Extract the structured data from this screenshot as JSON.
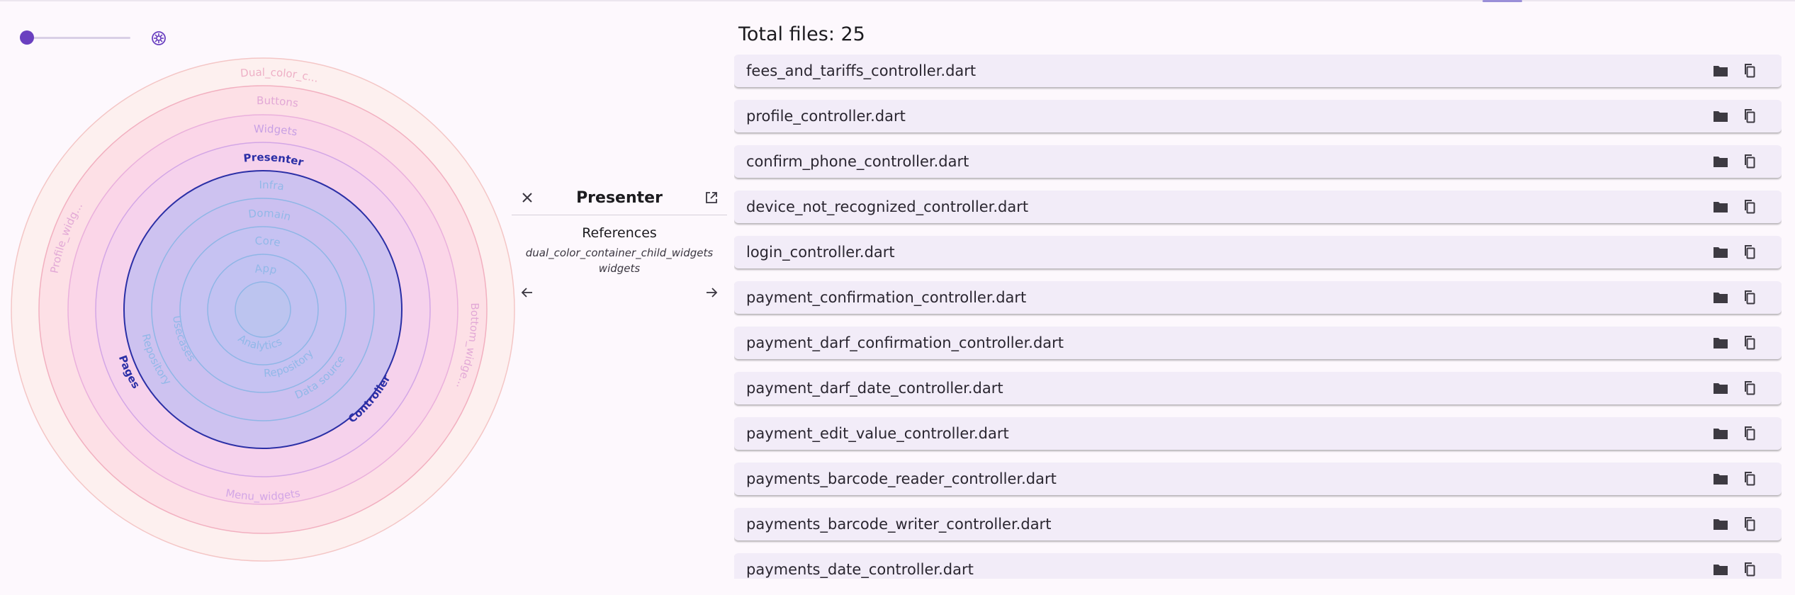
{
  "colors": {
    "accent": "#6a40c0",
    "row_background": "#f2ecf8",
    "page_background": "#fdf8fd",
    "selected_ring": "#2b2fa6"
  },
  "slider": {
    "value_fraction": 0.0
  },
  "rings": [
    {
      "label": "App",
      "selected": false
    },
    {
      "label": "Core",
      "selected": false
    },
    {
      "label": "Domain",
      "selected": false
    },
    {
      "label": "Infra",
      "selected": false
    },
    {
      "label": "Presenter",
      "selected": true
    },
    {
      "label": "Widgets",
      "selected": false
    },
    {
      "label": "Buttons",
      "selected": false
    },
    {
      "label": "Dual_color_c...",
      "selected": false
    }
  ],
  "ring_side_labels": [
    "Analytics",
    "Usecases",
    "Repository",
    "Data source",
    "Repository",
    "Pages",
    "Controller",
    "Profile_widg...",
    "Bottom_widge...",
    "Menu_widgets"
  ],
  "detail": {
    "title": "Presenter",
    "references_title": "References",
    "references": [
      "dual_color_container_child_widgets",
      "widgets"
    ]
  },
  "total_label": "Total files: 25",
  "files": [
    "fees_and_tariffs_controller.dart",
    "profile_controller.dart",
    "confirm_phone_controller.dart",
    "device_not_recognized_controller.dart",
    "login_controller.dart",
    "payment_confirmation_controller.dart",
    "payment_darf_confirmation_controller.dart",
    "payment_darf_date_controller.dart",
    "payment_edit_value_controller.dart",
    "payments_barcode_reader_controller.dart",
    "payments_barcode_writer_controller.dart",
    "payments_date_controller.dart"
  ],
  "icons": {
    "settings": "settings-wheel-icon",
    "close": "close-icon",
    "open": "open-in-new-icon",
    "prev": "arrow-back-icon",
    "next": "arrow-forward-icon",
    "folder": "folder-icon",
    "copy": "copy-icon"
  }
}
